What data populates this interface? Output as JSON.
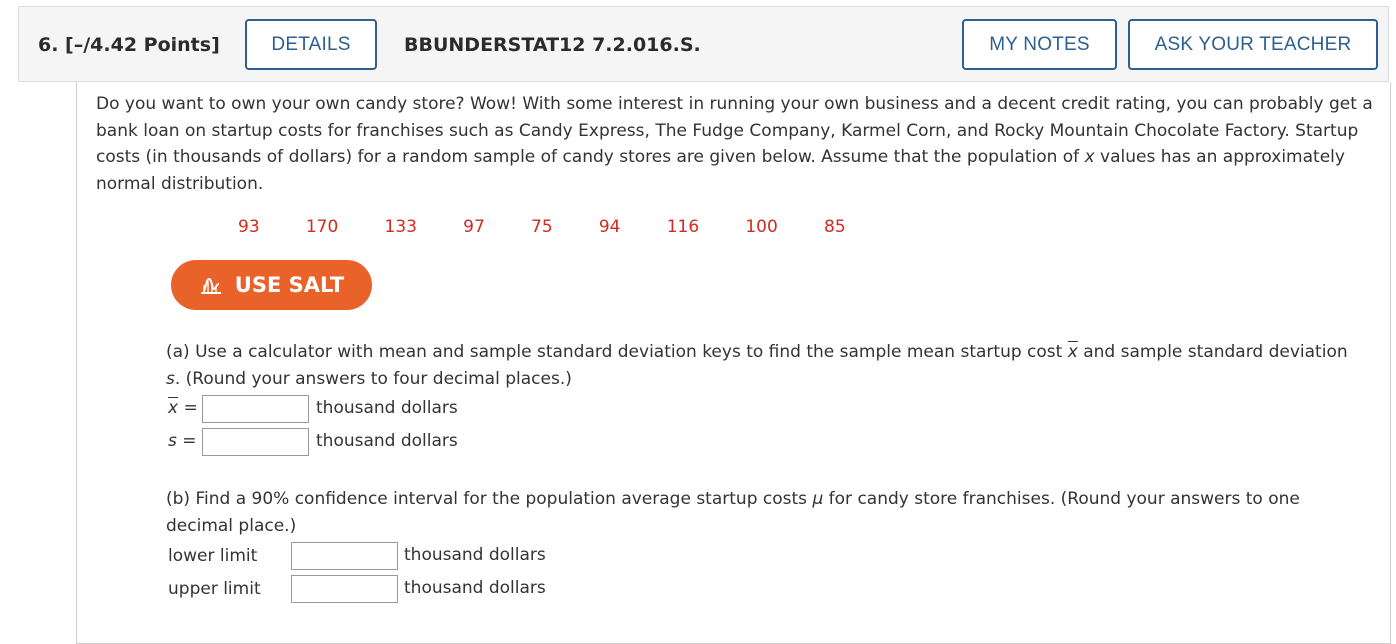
{
  "header": {
    "question_label": "6. [–/4.42 Points]",
    "details_button": "DETAILS",
    "problem_code": "BBUNDERSTAT12 7.2.016.S.",
    "my_notes_button": "MY NOTES",
    "ask_teacher_button": "ASK YOUR TEACHER"
  },
  "intro": {
    "line1": "Do you want to own your own candy store? Wow! With some interest in running your own business and a decent credit rating, you can probably get a bank loan on startup costs for franchises such as Candy Express, The Fudge Company, Karmel Corn, and Rocky Mountain Chocolate Factory. Startup costs (in thousands of dollars) for a random sample of candy stores are given below. Assume that the population of ",
    "var_x": "x",
    "line2": " values has an approximately normal distribution."
  },
  "data_values": "93   170   133   97   75   94   116   100   85",
  "salt_button": "USE SALT",
  "part_a": {
    "text1": "(a) Use a calculator with mean and sample standard deviation keys to find the sample mean startup cost ",
    "xbar": "x",
    "text2": " and sample standard deviation ",
    "s": "s",
    "text3": ". (Round your answers to four decimal places.)",
    "xbar_label": "x",
    "equals": "=",
    "s_label": "s",
    "unit": "thousand dollars",
    "xbar_value": "",
    "s_value": ""
  },
  "part_b": {
    "text1": "(b) Find a 90% confidence interval for the population average startup costs ",
    "mu": "μ",
    "text2": " for candy store franchises. (Round your answers to one decimal place.)",
    "lower_label": "lower limit",
    "upper_label": "upper limit",
    "unit": "thousand dollars",
    "lower_value": "",
    "upper_value": ""
  }
}
